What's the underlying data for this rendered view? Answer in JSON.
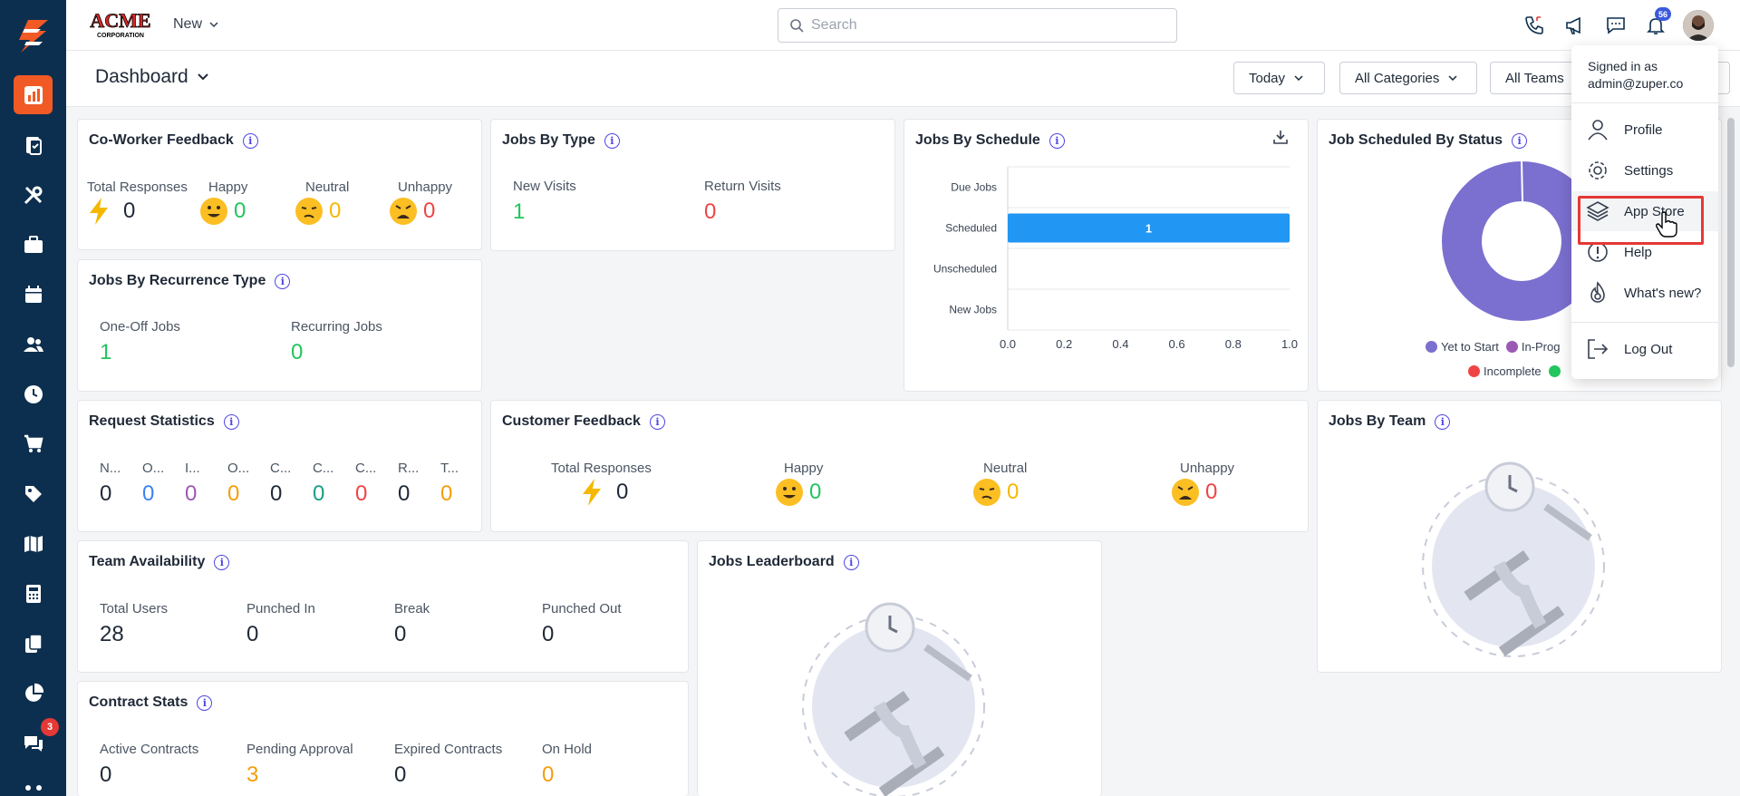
{
  "topbar": {
    "new_label": "New",
    "search_placeholder": "Search",
    "notification_count": "56"
  },
  "sidebar": {
    "chat_badge": "3"
  },
  "subbar": {
    "title": "Dashboard",
    "filters": [
      "Today",
      "All Categories",
      "All Teams"
    ]
  },
  "coworker_feedback": {
    "title": "Co-Worker Feedback",
    "labels": [
      "Total Responses",
      "Happy",
      "Neutral",
      "Unhappy"
    ],
    "values": [
      "0",
      "0",
      "0",
      "0"
    ]
  },
  "jobs_by_type": {
    "title": "Jobs By Type",
    "labels": [
      "New Visits",
      "Return Visits"
    ],
    "values": [
      "1",
      "0"
    ]
  },
  "jobs_by_schedule": {
    "title": "Jobs By Schedule"
  },
  "job_status": {
    "title": "Job Scheduled By Status",
    "legend": [
      "Yet to Start",
      "In-Prog",
      "Incomplete"
    ]
  },
  "recurrence": {
    "title": "Jobs By Recurrence Type",
    "labels": [
      "One-Off Jobs",
      "Recurring Jobs"
    ],
    "values": [
      "1",
      "0"
    ]
  },
  "request_stats": {
    "title": "Request Statistics",
    "labels": [
      "N...",
      "O...",
      "I...",
      "O...",
      "C...",
      "C...",
      "C...",
      "R...",
      "T..."
    ],
    "values": [
      "0",
      "0",
      "0",
      "0",
      "0",
      "0",
      "0",
      "0",
      "0"
    ]
  },
  "customer_feedback": {
    "title": "Customer Feedback",
    "labels": [
      "Total Responses",
      "Happy",
      "Neutral",
      "Unhappy"
    ],
    "values": [
      "0",
      "0",
      "0",
      "0"
    ]
  },
  "jobs_by_team": {
    "title": "Jobs By Team"
  },
  "team_availability": {
    "title": "Team Availability",
    "labels": [
      "Total Users",
      "Punched In",
      "Break",
      "Punched Out"
    ],
    "values": [
      "28",
      "0",
      "0",
      "0"
    ]
  },
  "leaderboard": {
    "title": "Jobs Leaderboard"
  },
  "contract_stats": {
    "title": "Contract Stats",
    "labels": [
      "Active Contracts",
      "Pending Approval",
      "Expired Contracts",
      "On Hold"
    ],
    "values": [
      "0",
      "3",
      "0",
      "0"
    ]
  },
  "user_menu": {
    "signed_in_label": "Signed in as",
    "email": "admin@zuper.co",
    "items": [
      "Profile",
      "Settings",
      "App Store",
      "Help",
      "What's new?",
      "Log Out"
    ]
  },
  "colors": {
    "sidebar": "#0d2f4f",
    "accent": "#f15a24",
    "bar": "#2196f3",
    "donut": "#7b6fd0"
  },
  "chart_data": {
    "type": "bar",
    "orientation": "horizontal",
    "categories": [
      "Due Jobs",
      "Scheduled",
      "Unscheduled",
      "New Jobs"
    ],
    "values": [
      0,
      1,
      0,
      0
    ],
    "xlim": [
      0,
      1
    ],
    "xticks": [
      "0.0",
      "0.2",
      "0.4",
      "0.6",
      "0.8",
      "1.0"
    ],
    "grid": true
  }
}
